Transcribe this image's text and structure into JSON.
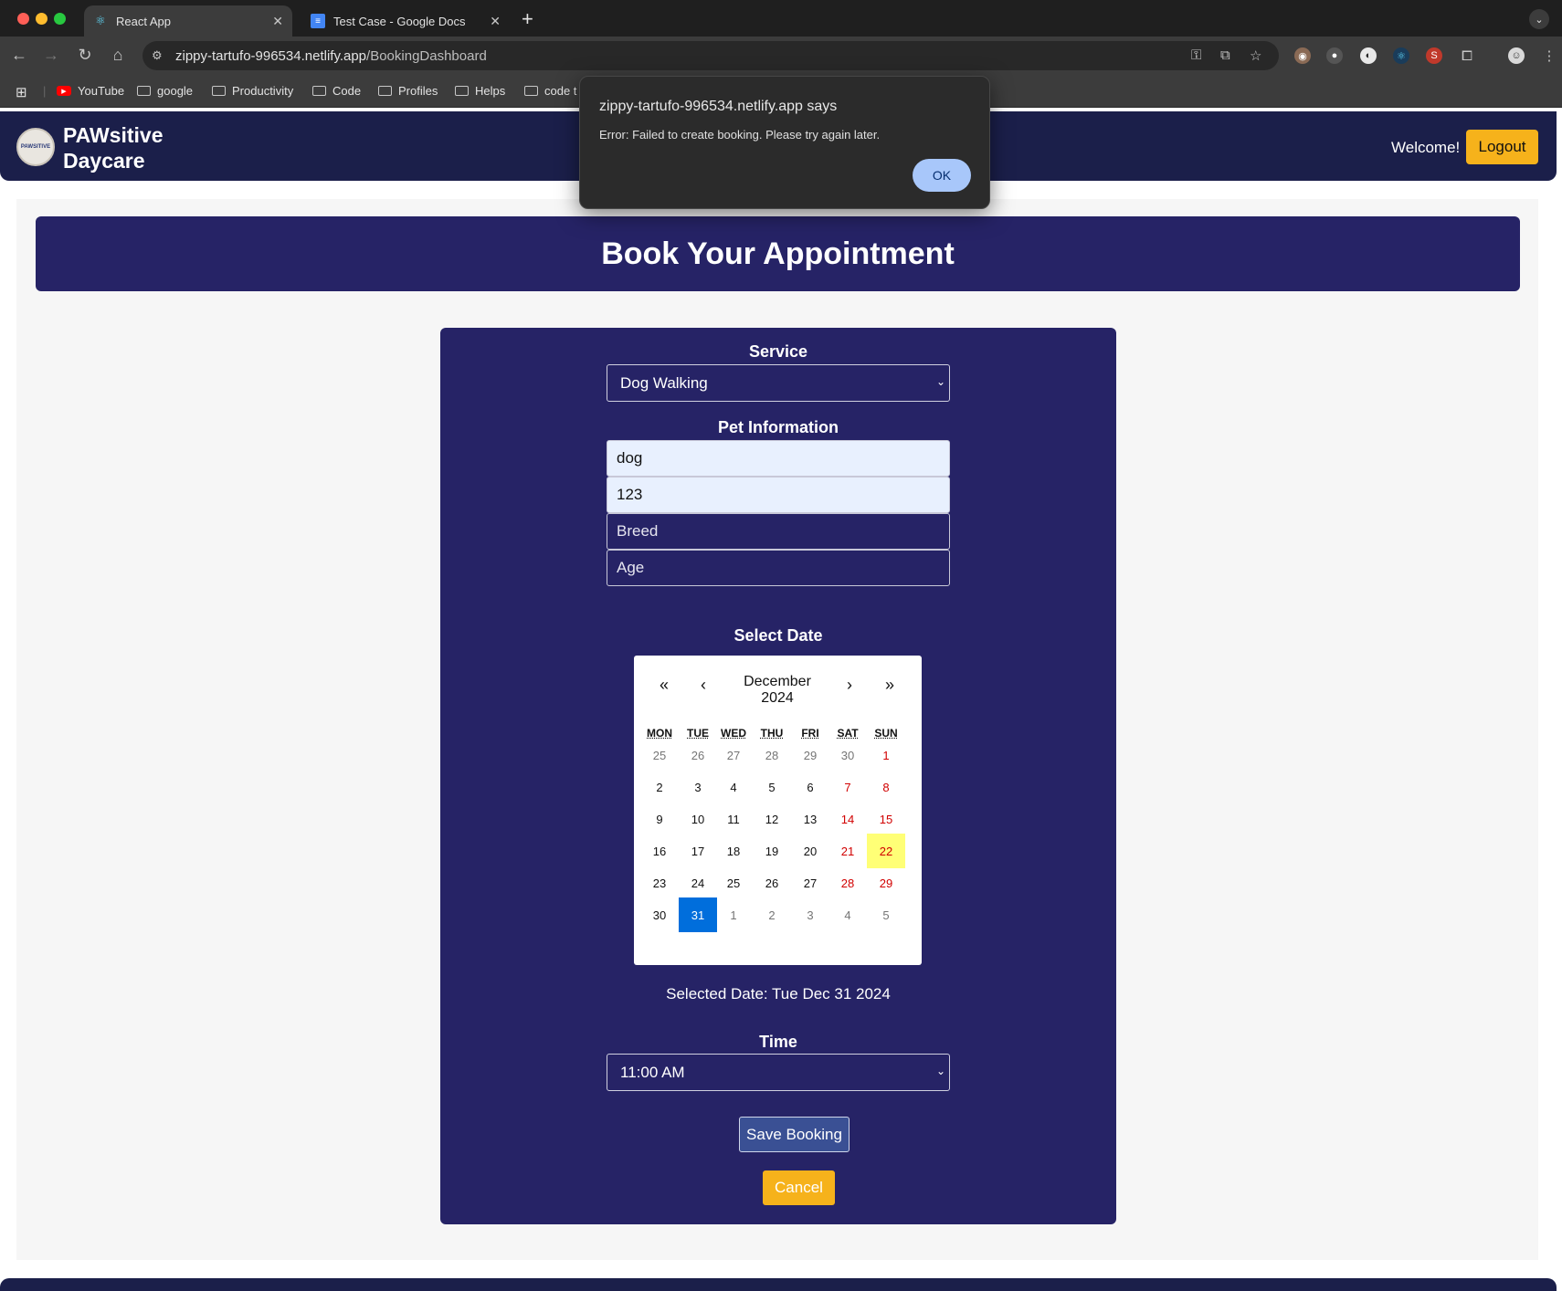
{
  "browser": {
    "tabs": [
      {
        "title": "React App",
        "active": true
      },
      {
        "title": "Test Case - Google Docs",
        "active": false
      }
    ],
    "url_host": "zippy-tartufo-996534.netlify.app",
    "url_path": "/BookingDashboard",
    "bookmarks": [
      "YouTube",
      "google",
      "Productivity",
      "Code",
      "Profiles",
      "Helps",
      "code t"
    ]
  },
  "header": {
    "brand_line1": "PAWsitive",
    "brand_line2": "Daycare",
    "logo_text": "PAWSITIVE",
    "welcome": "Welcome!",
    "logout_label": "Logout"
  },
  "page": {
    "title": "Book Your Appointment"
  },
  "form": {
    "service_label": "Service",
    "service_value": "Dog Walking",
    "pet_label": "Pet Information",
    "pet_name": "dog",
    "pet_id": "123",
    "breed_placeholder": "Breed",
    "age_placeholder": "Age",
    "date_label": "Select Date",
    "selected_date": "Selected Date: Tue Dec 31 2024",
    "time_label": "Time",
    "time_value": "11:00 AM",
    "save_label": "Save Booking",
    "cancel_label": "Cancel"
  },
  "calendar": {
    "nav": {
      "prev2": "«",
      "prev": "‹",
      "next": "›",
      "next2": "»"
    },
    "month": "December",
    "year": "2024",
    "weekdays": [
      "MON",
      "TUE",
      "WED",
      "THU",
      "FRI",
      "SAT",
      "SUN"
    ],
    "weeks": [
      [
        "25",
        "26",
        "27",
        "28",
        "29",
        "30",
        "1"
      ],
      [
        "2",
        "3",
        "4",
        "5",
        "6",
        "7",
        "8"
      ],
      [
        "9",
        "10",
        "11",
        "12",
        "13",
        "14",
        "15"
      ],
      [
        "16",
        "17",
        "18",
        "19",
        "20",
        "21",
        "22"
      ],
      [
        "23",
        "24",
        "25",
        "26",
        "27",
        "28",
        "29"
      ],
      [
        "30",
        "31",
        "1",
        "2",
        "3",
        "4",
        "5"
      ]
    ],
    "today": "22",
    "selected": "31"
  },
  "dialog": {
    "title": "zippy-tartufo-996534.netlify.app says",
    "message": "Error: Failed to create booking. Please try again later.",
    "ok_label": "OK"
  },
  "colors": {
    "header_bg": "#1b1f4a",
    "card_bg": "#262366",
    "accent_yellow": "#f6b21b",
    "selected_day": "#006edc",
    "today_day": "#ffff76"
  }
}
